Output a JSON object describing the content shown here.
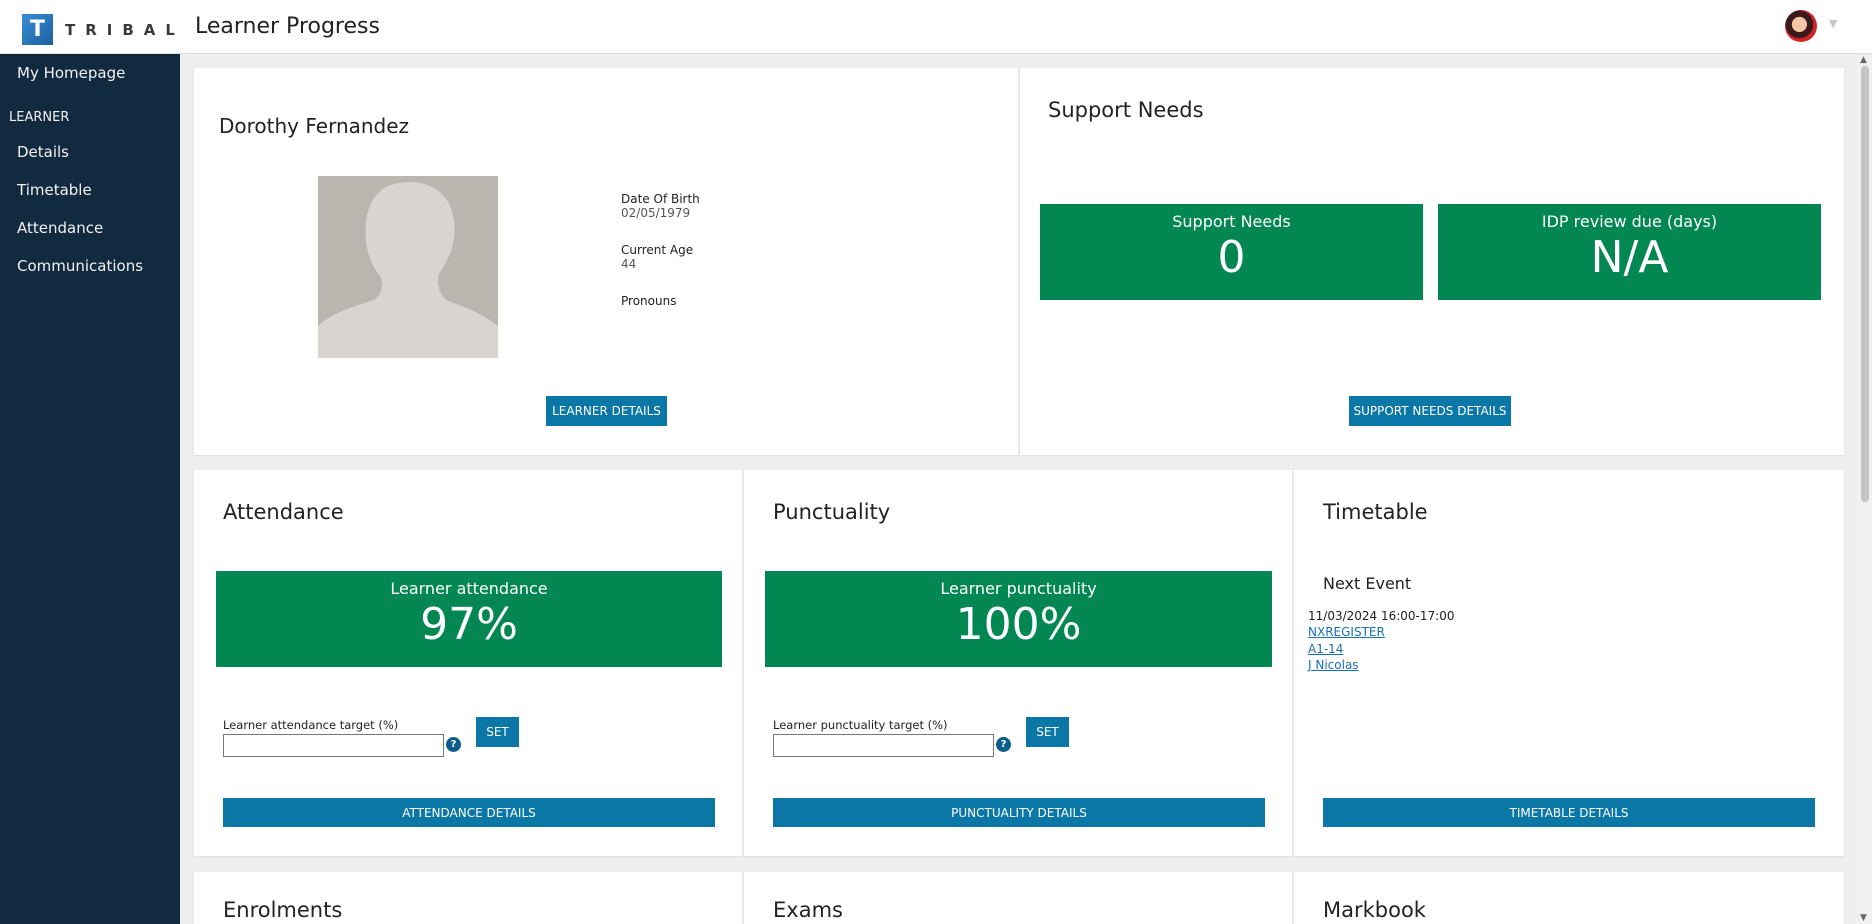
{
  "header": {
    "logo_letter": "T",
    "logo_text": "TRIBAL",
    "page_title": "Learner Progress"
  },
  "sidebar": {
    "home": "My Homepage",
    "section": "LEARNER",
    "items": [
      {
        "label": "Details"
      },
      {
        "label": "Timetable"
      },
      {
        "label": "Attendance"
      },
      {
        "label": "Communications"
      }
    ]
  },
  "learner": {
    "name": "Dorothy Fernandez",
    "dob_label": "Date Of Birth",
    "dob_value": "02/05/1979",
    "age_label": "Current Age",
    "age_value": "44",
    "pronouns_label": "Pronouns",
    "details_button": "LEARNER DETAILS"
  },
  "support": {
    "title": "Support Needs",
    "tile1_label": "Support Needs",
    "tile1_value": "0",
    "tile2_label": "IDP review due (days)",
    "tile2_value": "N/A",
    "details_button": "SUPPORT NEEDS DETAILS"
  },
  "attendance": {
    "title": "Attendance",
    "tile_label": "Learner attendance",
    "tile_value": "97%",
    "target_label": "Learner attendance target (%)",
    "target_value": "",
    "set_button": "SET",
    "details_button": "ATTENDANCE DETAILS"
  },
  "punctuality": {
    "title": "Punctuality",
    "tile_label": "Learner punctuality",
    "tile_value": "100%",
    "target_label": "Learner punctuality target (%)",
    "target_value": "",
    "set_button": "SET",
    "details_button": "PUNCTUALITY DETAILS"
  },
  "timetable": {
    "title": "Timetable",
    "next_event_label": "Next Event",
    "event_datetime": "11/03/2024 16:00-17:00",
    "event_register": "NXREGISTER",
    "event_room": "A1-14",
    "event_tutor": "J Nicolas",
    "details_button": "TIMETABLE DETAILS"
  },
  "bottom_cards": {
    "enrolments": "Enrolments",
    "exams": "Exams",
    "markbook": "Markbook"
  },
  "colors": {
    "sidebar_bg": "#112a40",
    "tile_green": "#028752",
    "button_blue": "#0b77a6"
  }
}
